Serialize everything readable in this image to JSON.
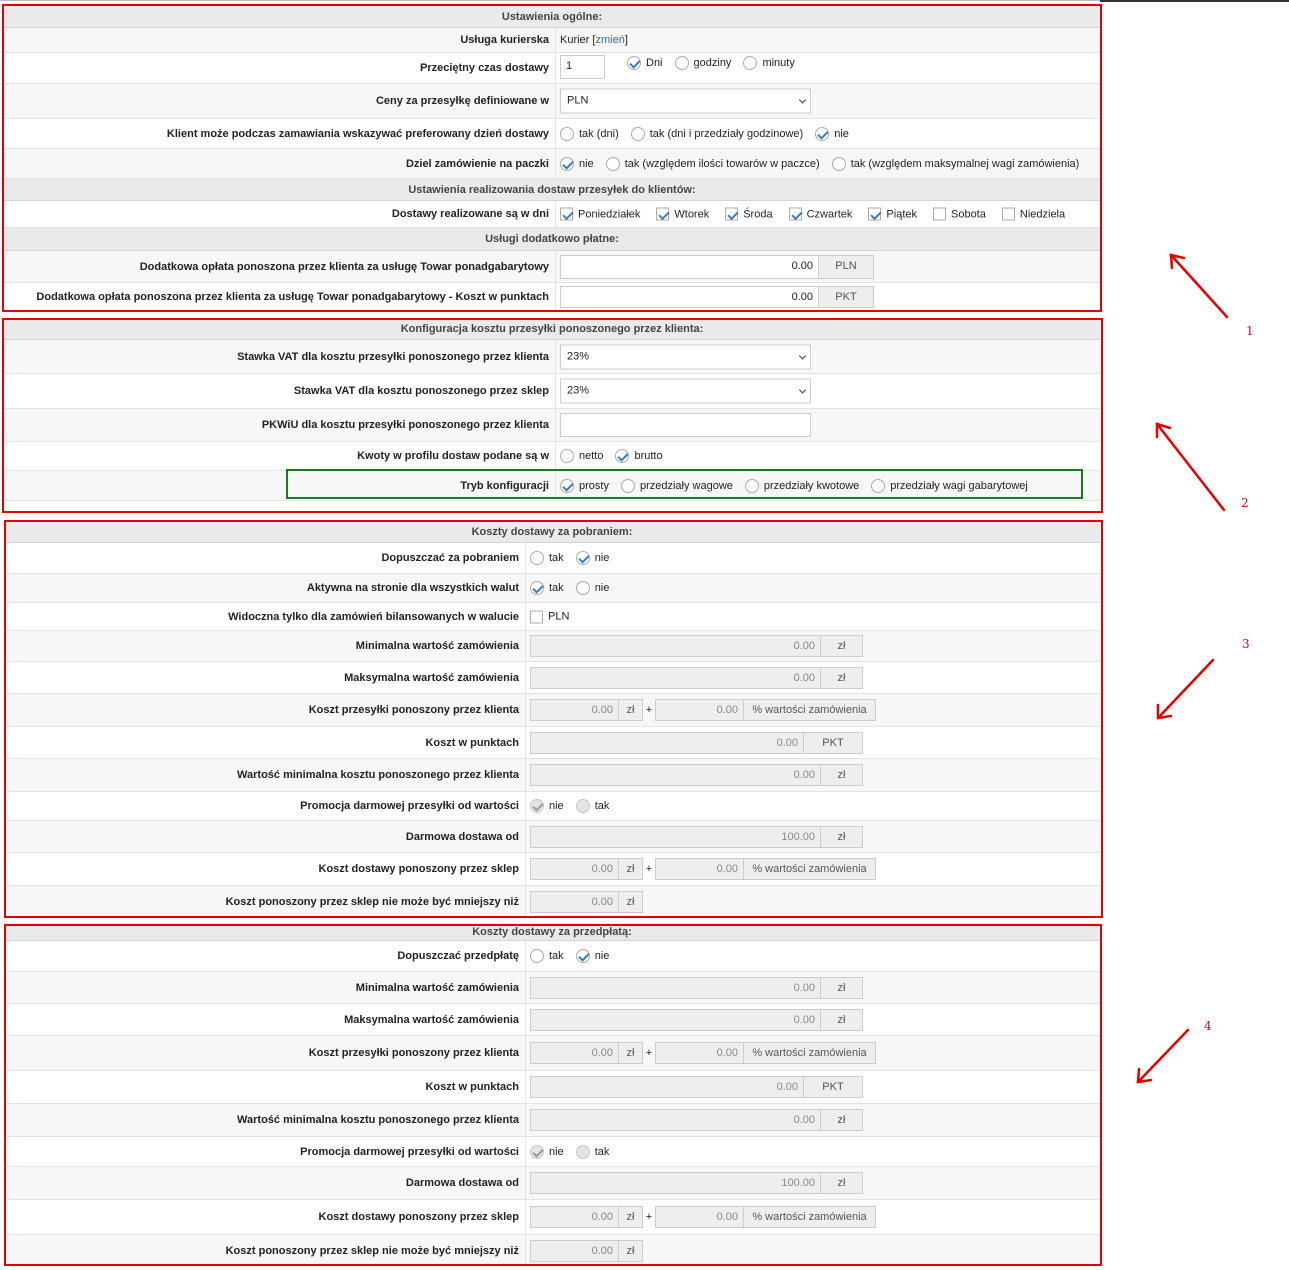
{
  "general": {
    "header": "Ustawienia ogólne:",
    "courier": {
      "label": "Usługa kurierska",
      "value": "Kurier",
      "bracket_open": "[",
      "link": "zmień",
      "bracket_close": "]"
    },
    "delivery_time": {
      "label": "Przeciętny czas dostawy",
      "value": "1",
      "opt_days": "Dni",
      "opt_hours": "godziny",
      "opt_minutes": "minuty"
    },
    "prices_in": {
      "label": "Ceny za przesyłkę definiowane w",
      "value": "PLN"
    },
    "preferred_day": {
      "label": "Klient może podczas zamawiania wskazywać preferowany dzień dostawy",
      "opt1": "tak (dni)",
      "opt2": "tak (dni i przedziały godzinowe)",
      "opt3": "nie"
    },
    "split": {
      "label": "Dziel zamówienie na paczki",
      "opt1": "nie",
      "opt2": "tak (względem ilości towarów w paczce)",
      "opt3": "tak (względem maksymalnej wagi zamówienia)"
    },
    "delivery_header": "Ustawienia realizowania dostaw przesyłek do klientów:",
    "days": {
      "label": "Dostawy realizowane są w dni",
      "items": [
        "Poniedziałek",
        "Wtorek",
        "Środa",
        "Czwartek",
        "Piątek",
        "Sobota",
        "Niedziela"
      ],
      "checked": [
        true,
        true,
        true,
        true,
        true,
        false,
        false
      ]
    },
    "extra_header": "Usługi dodatkowo płatne:",
    "oversize": {
      "label": "Dodatkowa opłata ponoszona przez klienta za usługę Towar ponadgabarytowy",
      "value": "0.00",
      "unit": "PLN"
    },
    "oversize_pts": {
      "label": "Dodatkowa opłata ponoszona przez klienta za usługę Towar ponadgabarytowy - Koszt w punktach",
      "value": "0.00",
      "unit": "PKT"
    }
  },
  "config": {
    "header": "Konfiguracja kosztu przesyłki ponoszonego przez klienta:",
    "vat_client": {
      "label": "Stawka VAT dla kosztu przesyłki ponoszonego przez klienta",
      "value": "23%"
    },
    "vat_shop": {
      "label": "Stawka VAT dla kosztu ponoszonego przez sklep",
      "value": "23%"
    },
    "pkwiu": {
      "label": "PKWiU dla kosztu przesyłki ponoszonego przez klienta",
      "value": ""
    },
    "amounts": {
      "label": "Kwoty w profilu dostaw podane są w",
      "opt1": "netto",
      "opt2": "brutto"
    },
    "mode": {
      "label": "Tryb konfiguracji",
      "opt1": "prosty",
      "opt2": "przedziały wagowe",
      "opt3": "przedziały kwotowe",
      "opt4": "przedziały wagi gabarytowej"
    }
  },
  "cod": {
    "header": "Koszty dostawy za pobraniem:",
    "allow": {
      "label": "Dopuszczać za pobraniem",
      "yes": "tak",
      "no": "nie"
    },
    "active": {
      "label": "Aktywna na stronie dla wszystkich walut",
      "yes": "tak",
      "no": "nie"
    },
    "visible": {
      "label": "Widoczna tylko dla zamówień bilansowanych w walucie",
      "opt": "PLN"
    },
    "min_order": {
      "label": "Minimalna wartość zamówienia",
      "value": "0.00",
      "unit": "zł"
    },
    "max_order": {
      "label": "Maksymalna wartość zamówienia",
      "value": "0.00",
      "unit": "zł"
    },
    "client_cost": {
      "label": "Koszt przesyłki ponoszony przez klienta",
      "value1": "0.00",
      "unit1": "zł",
      "plus": "+",
      "value2": "0.00",
      "unit2": "% wartości zamówienia"
    },
    "points": {
      "label": "Koszt w punktach",
      "value": "0.00",
      "unit": "PKT"
    },
    "min_client_cost": {
      "label": "Wartość minimalna kosztu ponoszonego przez klienta",
      "value": "0.00",
      "unit": "zł"
    },
    "promo": {
      "label": "Promocja darmowej przesyłki od wartości",
      "no": "nie",
      "yes": "tak"
    },
    "free_from": {
      "label": "Darmowa dostawa od",
      "value": "100.00",
      "unit": "zł"
    },
    "shop_cost": {
      "label": "Koszt dostawy ponoszony przez sklep",
      "value1": "0.00",
      "unit1": "zł",
      "plus": "+",
      "value2": "0.00",
      "unit2": "% wartości zamówienia"
    },
    "shop_min": {
      "label": "Koszt ponoszony przez sklep nie może być mniejszy niż",
      "value": "0.00",
      "unit": "zł"
    }
  },
  "prepaid": {
    "header": "Koszty dostawy za przedpłatą:",
    "allow": {
      "label": "Dopuszczać przedpłatę",
      "yes": "tak",
      "no": "nie"
    },
    "min_order": {
      "label": "Minimalna wartość zamówienia",
      "value": "0.00",
      "unit": "zł"
    },
    "max_order": {
      "label": "Maksymalna wartość zamówienia",
      "value": "0.00",
      "unit": "zł"
    },
    "client_cost": {
      "label": "Koszt przesyłki ponoszony przez klienta",
      "value1": "0.00",
      "unit1": "zł",
      "plus": "+",
      "value2": "0.00",
      "unit2": "% wartości zamówienia"
    },
    "points": {
      "label": "Koszt w punktach",
      "value": "0.00",
      "unit": "PKT"
    },
    "min_client_cost": {
      "label": "Wartość minimalna kosztu ponoszonego przez klienta",
      "value": "0.00",
      "unit": "zł"
    },
    "promo": {
      "label": "Promocja darmowej przesyłki od wartości",
      "no": "nie",
      "yes": "tak"
    },
    "free_from": {
      "label": "Darmowa dostawa od",
      "value": "100.00",
      "unit": "zł"
    },
    "shop_cost": {
      "label": "Koszt dostawy ponoszony przez sklep",
      "value1": "0.00",
      "unit1": "zł",
      "plus": "+",
      "value2": "0.00",
      "unit2": "% wartości zamówienia"
    },
    "shop_min": {
      "label": "Koszt ponoszony przez sklep nie może być mniejszy niż",
      "value": "0.00",
      "unit": "zł"
    }
  },
  "annotations": [
    "1",
    "2",
    "3",
    "4"
  ],
  "colors": {
    "annotation_red": "#e30000",
    "annotation_green": "#1a7d1a",
    "checkmark": "#3a7bc8"
  }
}
